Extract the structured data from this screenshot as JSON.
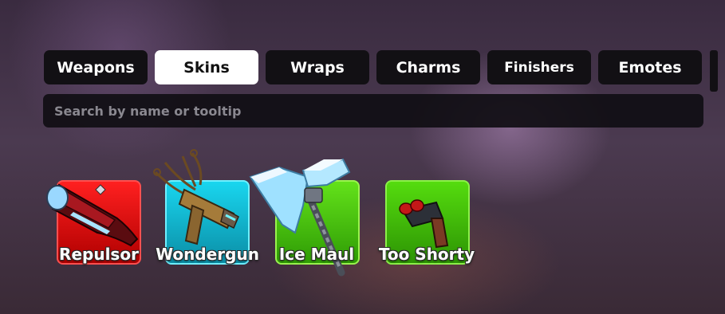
{
  "tabs": [
    {
      "label": "Weapons",
      "active": false
    },
    {
      "label": "Skins",
      "active": true
    },
    {
      "label": "Wraps",
      "active": false
    },
    {
      "label": "Charms",
      "active": false
    },
    {
      "label": "Finishers",
      "active": false
    },
    {
      "label": "Emotes",
      "active": false
    }
  ],
  "search": {
    "placeholder": "Search by name or tooltip",
    "value": ""
  },
  "items": [
    {
      "name": "Repulsor",
      "rarity_color": "#e01010",
      "icon": "repulsor-icon"
    },
    {
      "name": "Wondergun",
      "rarity_color": "#14c0dc",
      "icon": "wondergun-icon"
    },
    {
      "name": "Ice Maul",
      "rarity_color": "#4fcc10",
      "icon": "ice-maul-icon"
    },
    {
      "name": "Too Shorty",
      "rarity_color": "#4fcc10",
      "icon": "too-shorty-icon"
    }
  ]
}
